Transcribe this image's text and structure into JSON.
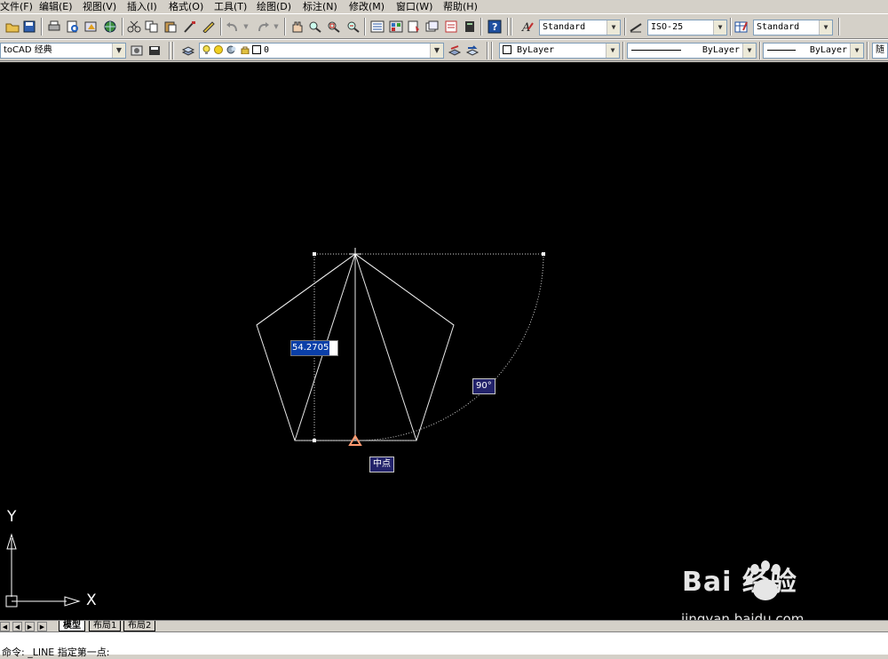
{
  "menu": [
    "文件(F)",
    "编辑(E)",
    "视图(V)",
    "插入(I)",
    "格式(O)",
    "工具(T)",
    "绘图(D)",
    "标注(N)",
    "修改(M)",
    "窗口(W)",
    "帮助(H)"
  ],
  "toolbar1": {
    "text_style": "Standard",
    "dim_style": "ISO-25",
    "table_style": "Standard"
  },
  "toolbar2": {
    "workspace": "toCAD 经典",
    "layer": "0",
    "color": "ByLayer",
    "linetype": "ByLayer",
    "lineweight": "ByLayer",
    "plotstyle": "随"
  },
  "drawing": {
    "dynamic_input_value": "54.2705",
    "angle_tooltip": "90°",
    "snap_tooltip": "中点",
    "ucs_x": "X",
    "ucs_y": "Y"
  },
  "tabs": {
    "model": "模型",
    "layout1": "布局1",
    "layout2": "布局2"
  },
  "command": {
    "text": "命令: _LINE 指定第一点:"
  },
  "watermark": {
    "logo": "Bai 经验",
    "url": "jingyan.baidu.com"
  }
}
